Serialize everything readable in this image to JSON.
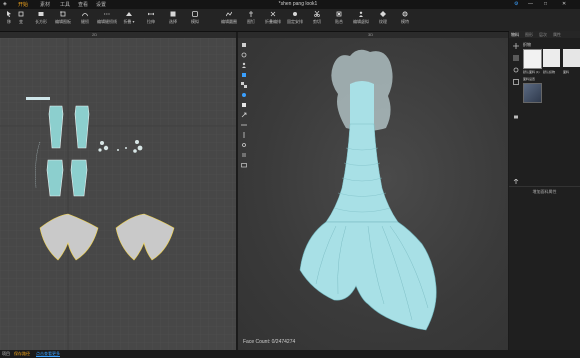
{
  "menu": {
    "items": [
      "开始",
      "素材",
      "工具",
      "查看",
      "设置"
    ],
    "active_index": 0,
    "accent": "#f2a51c"
  },
  "window": {
    "title": "*shen pang look1",
    "controls": [
      "⚙",
      "—",
      "□",
      "✕"
    ]
  },
  "toolbar": {
    "items": [
      {
        "icon": "select-icon",
        "label": "移"
      },
      {
        "icon": "transform-icon",
        "label": "变"
      },
      {
        "icon": "rectangle-icon",
        "label": "长方形"
      },
      {
        "icon": "edit-pattern-icon",
        "label": "编辑图板"
      },
      {
        "icon": "seam-icon",
        "label": "缝纫"
      },
      {
        "icon": "edit-seam-icon",
        "label": "编辑缝纫线"
      },
      {
        "icon": "fold-icon",
        "label": "折叠 ▾"
      },
      {
        "icon": "stretch-icon",
        "label": "拉伸"
      },
      {
        "icon": "select-3d-icon",
        "label": "选择"
      },
      {
        "icon": "simulate-icon",
        "label": "模拟"
      },
      {
        "icon": "arrange-icon",
        "label": "编辑圆圈"
      },
      {
        "icon": "pin-icon",
        "label": "图钉"
      },
      {
        "icon": "fold-arrange-icon",
        "label": "折叠编排"
      },
      {
        "icon": "arrange-point-icon",
        "label": "固定安排"
      },
      {
        "icon": "trim-icon",
        "label": "剪切"
      },
      {
        "icon": "fit-icon",
        "label": "贴合"
      },
      {
        "icon": "avatar-edit-icon",
        "label": "编辑虚拟"
      },
      {
        "icon": "texture-icon",
        "label": "纹理"
      },
      {
        "icon": "settings-icon",
        "label": "模特"
      }
    ]
  },
  "pattern_window": {
    "tag": "2D"
  },
  "avatar_window": {
    "tag": "3D",
    "face_count": "Face Count: 0/2474274"
  },
  "right_panel": {
    "tabs": [
      "物料",
      "图形",
      "层次",
      "属性"
    ],
    "active_tab": 0,
    "section_title": "织物",
    "swatches": [
      {
        "label": "默认面料 (1)",
        "color": "#f2f2f2"
      },
      {
        "label": "默认织物",
        "color": "#ececec"
      },
      {
        "label": "面料",
        "color": "#e6e6e6"
      }
    ],
    "sub_title": "面料设置",
    "add_button": "增加面料属性",
    "tools": [
      "swatch-add-icon",
      "swatch-list-icon",
      "swatch-settings-icon",
      "swatch-grid-icon",
      "swatch-lock-icon",
      "swatch-export-icon"
    ]
  },
  "status": {
    "left": "项目",
    "warn": "保存路径",
    "link": "点击查看更多"
  },
  "colors": {
    "accent": "#f2a51c",
    "blue_link": "#3aa0ff",
    "garment": "#a8e0e6",
    "pattern_fill": "#8ccfce",
    "pattern_line": "#f2d34b"
  }
}
